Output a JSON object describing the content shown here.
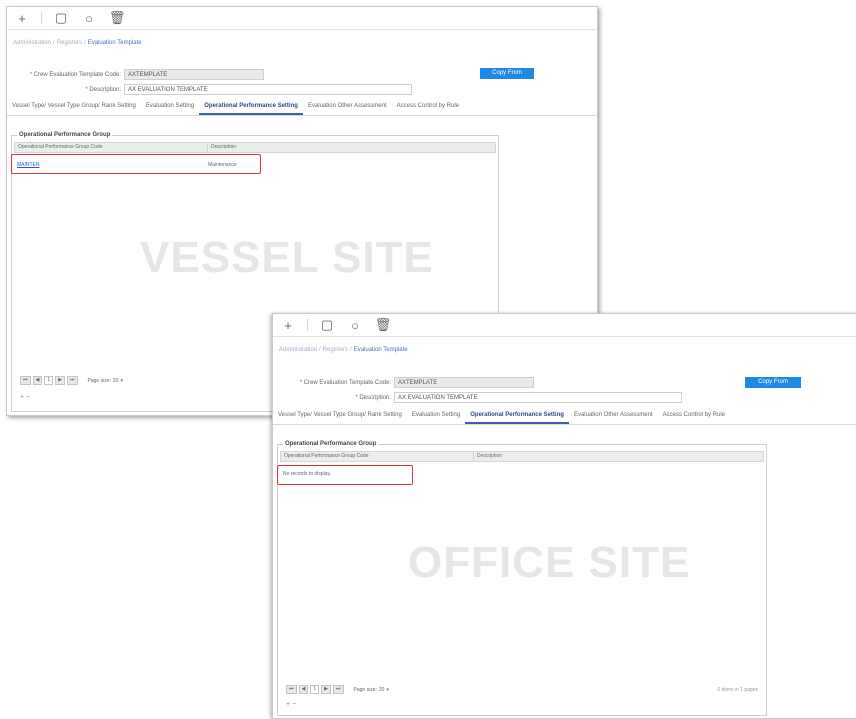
{
  "toolbar": {
    "icons": [
      "plus-icon",
      "document-icon",
      "refresh-icon",
      "trash-icon"
    ],
    "glyphs": [
      "+",
      "▢",
      "○",
      "🗑"
    ]
  },
  "breadcrumb": {
    "items": [
      "Administration",
      "Registers",
      "Evaluation Template"
    ],
    "separator": "/"
  },
  "form": {
    "code_label": "* Crew Evaluation Template Code:",
    "code_value": "AXTEMPLATE",
    "desc_label": "* Description:",
    "desc_value": "AX EVALUATION TEMPLATE",
    "copy_label": "Copy From"
  },
  "tabs": [
    {
      "label": "Vessel Type/ Vessel Type Group/ Rank Setting",
      "active": false
    },
    {
      "label": "Evaluation Setting",
      "active": false
    },
    {
      "label": "Operational Performance Setting",
      "active": true
    },
    {
      "label": "Evaluation Other Assessment",
      "active": false
    },
    {
      "label": "Access Control by Rule",
      "active": false
    }
  ],
  "group": {
    "title": "Operational Performance Group",
    "col_code": "Operational Performance Group Code",
    "col_desc": "Description"
  },
  "vessel": {
    "watermark": "VESSEL SITE",
    "row_code": "MAINTEN",
    "row_desc": "Maintenance",
    "page_size_label": "Page size:",
    "page_size": "20"
  },
  "office": {
    "watermark": "OFFICE SITE",
    "empty_text": "No records to display.",
    "page_size_label": "Page size:",
    "page_size": "20",
    "page_info": "0 items in 1 pages"
  },
  "pager": {
    "first": "⏮",
    "prev": "◀",
    "page": "1",
    "next": "▶",
    "last": "⏭"
  },
  "add_row": {
    "add": "+",
    "remove": "−"
  },
  "colors": {
    "accent": "#1e88e5",
    "highlight": "#d9303a",
    "tab_active": "#2b4b86"
  }
}
